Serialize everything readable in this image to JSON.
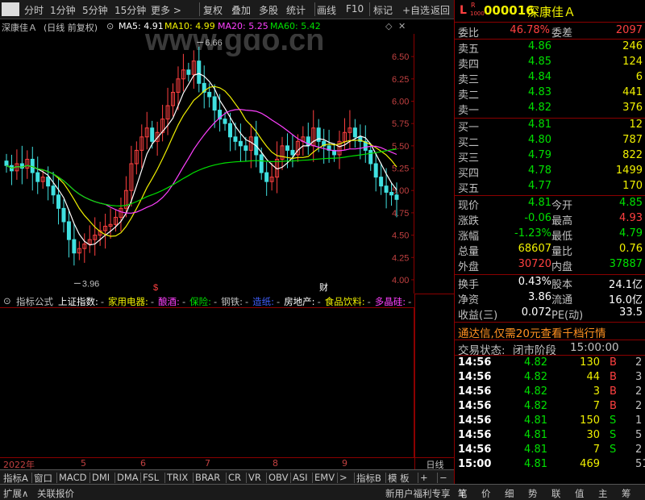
{
  "toolbar": {
    "items": [
      "分时",
      "1分钟",
      "5分钟",
      "15分钟",
      "更多 >",
      "复权",
      "叠加",
      "多股",
      "统计",
      "画线",
      "F10",
      "标记",
      "+自选",
      "返回"
    ]
  },
  "stock_info": {
    "name": "深康佳Ａ",
    "mode": "(日线 前复权)",
    "ma5_label": "MA5: 4.91",
    "ma10_label": "MA10: 4.99",
    "ma20_label": "MA20: 5.25",
    "ma60_label": "MA60: 5.42",
    "ma_colors": {
      "ma5": "#ffffff",
      "ma10": "#f0f000",
      "ma20": "#ff40ff",
      "ma60": "#00e000"
    }
  },
  "watermark": "www.gdo.cn",
  "chart_data": {
    "type": "candlestick",
    "title": "深康佳Ａ (日线 前复权)",
    "y_ticks": [
      "6.50",
      "6.25",
      "6.00",
      "5.75",
      "5.50",
      "5.25",
      "5.00",
      "4.75",
      "4.50",
      "4.25",
      "4.00"
    ],
    "ylim": [
      3.9,
      6.7
    ],
    "annotations": {
      "high": "6.66",
      "low": "3.96"
    },
    "event_marks": [
      {
        "label": "$",
        "color": "#ff4040"
      },
      {
        "label": "财",
        "color": "#ffffff"
      }
    ],
    "x_ticks": [
      "2022年",
      "5",
      "6",
      "7",
      "8",
      "9"
    ],
    "close_series": [
      5.28,
      5.22,
      5.3,
      5.25,
      5.35,
      5.2,
      5.1,
      5.15,
      5.05,
      4.95,
      4.8,
      4.65,
      4.45,
      4.3,
      4.35,
      4.4,
      4.45,
      4.5,
      4.55,
      4.6,
      4.62,
      4.7,
      4.8,
      5.0,
      5.3,
      5.45,
      5.6,
      5.7,
      5.55,
      5.65,
      5.8,
      5.95,
      6.1,
      6.25,
      6.35,
      6.3,
      6.45,
      6.2,
      6.1,
      6.05,
      5.9,
      5.8,
      5.75,
      5.6,
      5.55,
      5.5,
      5.45,
      5.6,
      5.4,
      5.2,
      5.1,
      5.15,
      5.35,
      5.5,
      5.45,
      5.4,
      5.55,
      5.6,
      5.5,
      5.7,
      5.55,
      5.5,
      5.45,
      5.4,
      5.55,
      5.65,
      5.7,
      5.6,
      5.55,
      5.45,
      5.3,
      5.15,
      5.05,
      4.98,
      4.95,
      4.9
    ],
    "ma_series": [
      {
        "name": "MA5",
        "color": "#ffffff"
      },
      {
        "name": "MA10",
        "color": "#f0f000"
      },
      {
        "name": "MA20",
        "color": "#ff40ff"
      },
      {
        "name": "MA60",
        "color": "#00e000"
      }
    ]
  },
  "indicator": {
    "label": "指标公式",
    "items": [
      {
        "text": "上证指数:",
        "color": "#ffffff"
      },
      {
        "text": "家用电器:",
        "color": "#f0f000"
      },
      {
        "text": "酿酒:",
        "color": "#ff40ff"
      },
      {
        "text": "保险:",
        "color": "#00e000"
      },
      {
        "text": "钢铁:",
        "color": "#c0c0c0"
      },
      {
        "text": "造纸:",
        "color": "#4060ff"
      },
      {
        "text": "房地产:",
        "color": "#ffffff"
      },
      {
        "text": "食品饮料:",
        "color": "#f0f000"
      },
      {
        "text": "多晶硅:",
        "color": "#ff40ff"
      }
    ]
  },
  "time_axis": {
    "labels": [
      "2022年",
      "5",
      "6",
      "7",
      "8",
      "9"
    ],
    "day_label": "日线"
  },
  "tabs": [
    "指标A",
    "窗口",
    "MACD",
    "DMI",
    "DMA",
    "FSL",
    "TRIX",
    "BRAR",
    "CR",
    "VR",
    "OBV",
    "ASI",
    "EMV",
    ">",
    "指标B",
    "模 板",
    "+",
    "−"
  ],
  "bottom": {
    "left": [
      "扩展∧",
      "关联报价"
    ],
    "promo": "新用户福利专享",
    "nav": [
      "笔",
      "价",
      "细",
      "势",
      "联",
      "值",
      "主",
      "筹"
    ]
  },
  "quote": {
    "code": "000016",
    "name": "深康佳Ａ",
    "badge_l": "L",
    "badge_r": "R",
    "badge_num": "1000",
    "weibi_label": "委比",
    "weibi": "46.78%",
    "weicha_label": "委差",
    "weicha": "2097",
    "asks": [
      {
        "label": "卖五",
        "price": "4.86",
        "vol": "246"
      },
      {
        "label": "卖四",
        "price": "4.85",
        "vol": "124"
      },
      {
        "label": "卖三",
        "price": "4.84",
        "vol": "6"
      },
      {
        "label": "卖二",
        "price": "4.83",
        "vol": "441"
      },
      {
        "label": "卖一",
        "price": "4.82",
        "vol": "376"
      }
    ],
    "bids": [
      {
        "label": "买一",
        "price": "4.81",
        "vol": "12"
      },
      {
        "label": "买二",
        "price": "4.80",
        "vol": "787"
      },
      {
        "label": "买三",
        "price": "4.79",
        "vol": "822"
      },
      {
        "label": "买四",
        "price": "4.78",
        "vol": "1499"
      },
      {
        "label": "买五",
        "price": "4.77",
        "vol": "170"
      }
    ],
    "stats": [
      {
        "l1": "现价",
        "v1": "4.81",
        "c1": "grn",
        "l2": "今开",
        "v2": "4.85",
        "c2": "grn"
      },
      {
        "l1": "涨跌",
        "v1": "-0.06",
        "c1": "grn",
        "l2": "最高",
        "v2": "4.93",
        "c2": "red"
      },
      {
        "l1": "涨幅",
        "v1": "-1.23%",
        "c1": "grn",
        "l2": "最低",
        "v2": "4.79",
        "c2": "grn"
      },
      {
        "l1": "总量",
        "v1": "68607",
        "c1": "yel",
        "l2": "量比",
        "v2": "0.76",
        "c2": "yel"
      },
      {
        "l1": "外盘",
        "v1": "30720",
        "c1": "red",
        "l2": "内盘",
        "v2": "37887",
        "c2": "grn"
      }
    ],
    "finance": [
      {
        "l1": "换手",
        "v1": "0.43%",
        "l2": "股本",
        "v2": "24.1亿"
      },
      {
        "l1": "净资",
        "v1": "3.86",
        "l2": "流通",
        "v2": "16.0亿"
      },
      {
        "l1": "收益(三)",
        "v1": "0.072",
        "l2": "PE(动)",
        "v2": "33.5"
      }
    ],
    "promo": "通达信,仅需20元查看千档行情",
    "status_label": "交易状态:",
    "status_value": "闭市阶段",
    "status_time": "15:00:00",
    "ticks": [
      {
        "time": "14:56",
        "price": "4.82",
        "vol": "130",
        "side": "B",
        "n": "2"
      },
      {
        "time": "14:56",
        "price": "4.82",
        "vol": "44",
        "side": "B",
        "n": "3"
      },
      {
        "time": "14:56",
        "price": "4.82",
        "vol": "3",
        "side": "B",
        "n": "2"
      },
      {
        "time": "14:56",
        "price": "4.82",
        "vol": "7",
        "side": "B",
        "n": "2"
      },
      {
        "time": "14:56",
        "price": "4.81",
        "vol": "150",
        "side": "S",
        "n": "1"
      },
      {
        "time": "14:56",
        "price": "4.81",
        "vol": "30",
        "side": "S",
        "n": "5"
      },
      {
        "time": "14:56",
        "price": "4.81",
        "vol": "7",
        "side": "S",
        "n": "2"
      },
      {
        "time": "15:00",
        "price": "4.81",
        "vol": "469",
        "side": "",
        "n": "51"
      }
    ]
  }
}
